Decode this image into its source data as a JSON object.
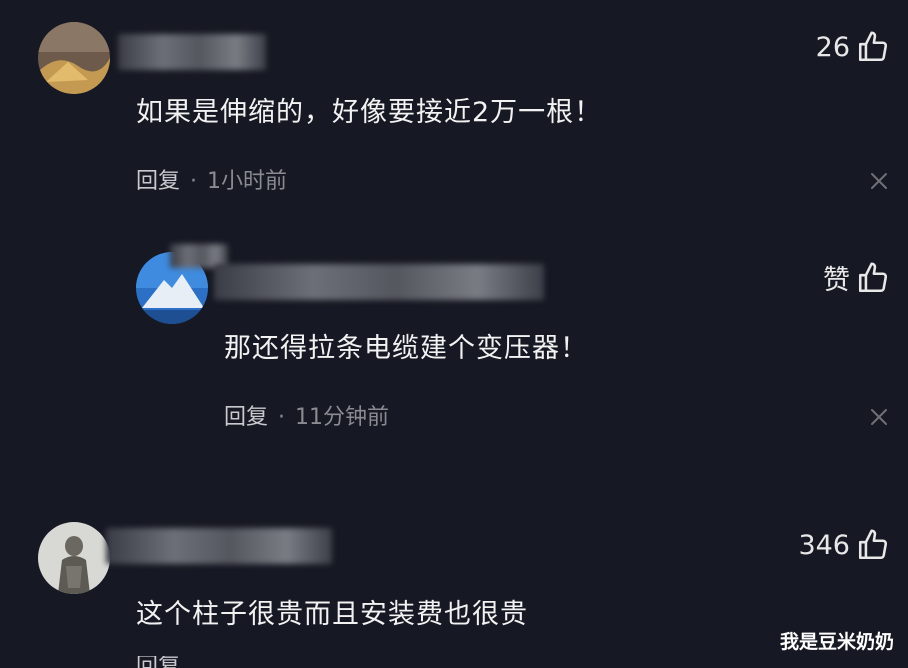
{
  "comments": [
    {
      "text": "如果是伸缩的，好像要接近2万一根！",
      "likes": "26",
      "reply_label": "回复",
      "dot": "·",
      "time": "1小时前"
    },
    {
      "text": "那还得拉条电缆建个变压器！",
      "likes": "赞",
      "reply_label": "回复",
      "dot": "·",
      "time": "11分钟前"
    },
    {
      "text": "这个柱子很贵而且安装费也很贵",
      "likes": "346",
      "reply_label": "回复"
    }
  ],
  "watermark": "我是豆米奶奶",
  "icons": {
    "like": "thumbs-up-icon",
    "close": "close-icon"
  },
  "colors": {
    "background": "#161823",
    "text": "#f2f2f2",
    "meta": "#8a8b91"
  }
}
